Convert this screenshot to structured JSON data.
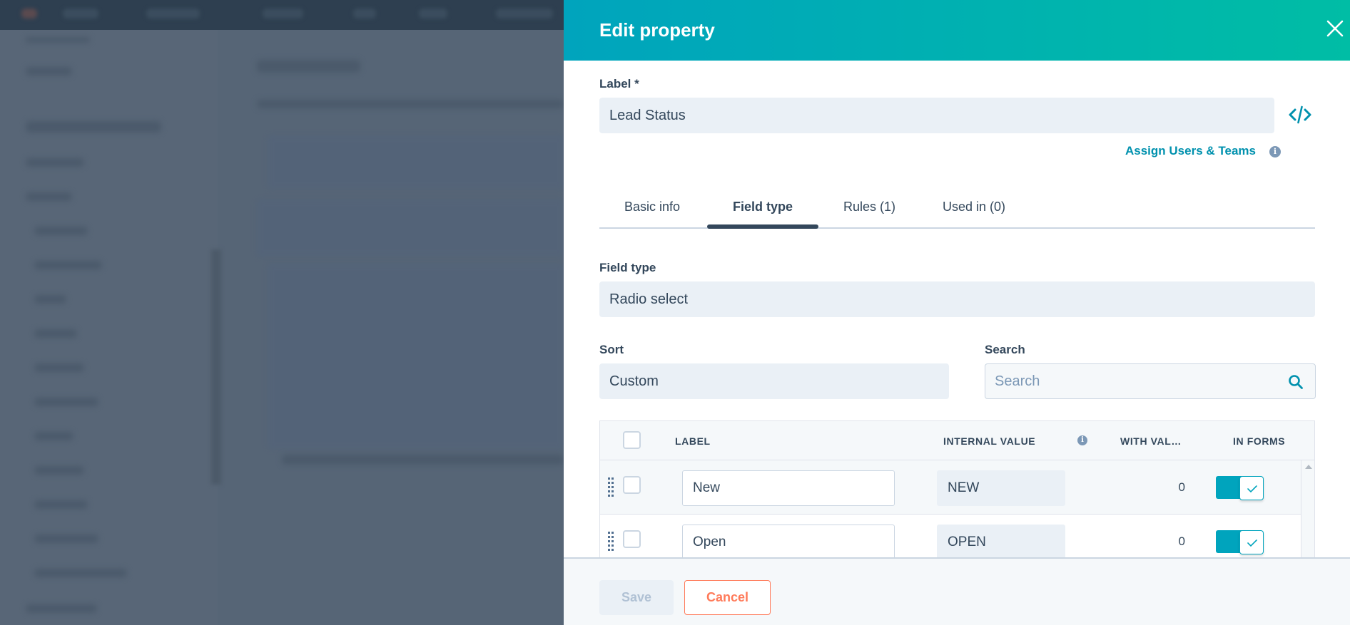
{
  "modal": {
    "title": "Edit property",
    "close_icon": "close-icon",
    "label_field": {
      "label": "Label *",
      "value": "Lead Status"
    },
    "code_icon": "code-icon",
    "assign_link": "Assign Users & Teams",
    "info_icon_glyph": "i",
    "tabs": [
      {
        "label": "Basic info",
        "active": false
      },
      {
        "label": "Field type",
        "active": true
      },
      {
        "label": "Rules (1)",
        "active": false
      },
      {
        "label": "Used in (0)",
        "active": false
      }
    ],
    "field_type": {
      "label": "Field type",
      "value": "Radio select"
    },
    "sort": {
      "label": "Sort",
      "value": "Custom"
    },
    "search": {
      "label": "Search",
      "placeholder": "Search",
      "value": ""
    },
    "table": {
      "columns": [
        "LABEL",
        "INTERNAL VALUE",
        "WITH VAL…",
        "IN FORMS"
      ],
      "rows": [
        {
          "label": "New",
          "internal_value": "NEW",
          "with_value": "0",
          "in_forms": true,
          "selected": false
        },
        {
          "label": "Open",
          "internal_value": "OPEN",
          "with_value": "0",
          "in_forms": true,
          "selected": false
        }
      ]
    },
    "footer": {
      "save_label": "Save",
      "save_disabled": true,
      "cancel_label": "Cancel"
    }
  },
  "colors": {
    "header_gradient_start": "#00a4bd",
    "header_gradient_end": "#00bda5",
    "link": "#0091ae",
    "toggle_on": "#00a4bd",
    "cancel": "#ff7a59",
    "text": "#33475b",
    "input_bg": "#eaf0f6",
    "overlay": "#566576"
  }
}
